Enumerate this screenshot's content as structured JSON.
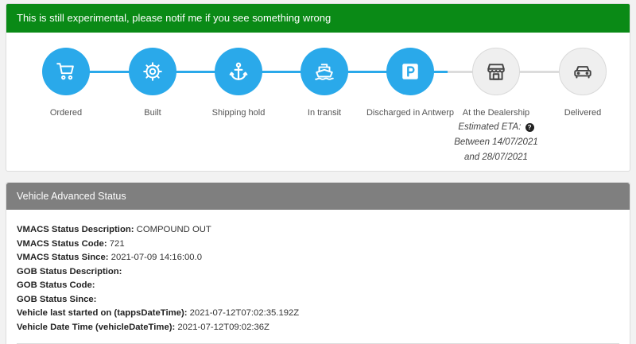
{
  "banner": {
    "text": "This is still experimental, please notif me if you see something wrong"
  },
  "colors": {
    "banner": "#0a8a16",
    "step_done": "#2aa9ea",
    "step_todo": "#efefef",
    "panel_header": "#7f7f7f"
  },
  "steps": [
    {
      "label": "Ordered",
      "icon": "cart-icon",
      "status": "done"
    },
    {
      "label": "Built",
      "icon": "gear-icon",
      "status": "done"
    },
    {
      "label": "Shipping hold",
      "icon": "anchor-icon",
      "status": "done"
    },
    {
      "label": "In transit",
      "icon": "ship-icon",
      "status": "done"
    },
    {
      "label": "Discharged in Antwerp",
      "icon": "parking-icon",
      "status": "done"
    },
    {
      "label": "At the Dealership",
      "icon": "store-icon",
      "status": "todo"
    },
    {
      "label": "Delivered",
      "icon": "car-icon",
      "status": "todo"
    }
  ],
  "eta": {
    "label": "Estimated ETA:",
    "help_icon": "question-circle-icon",
    "help_glyph": "?",
    "line1": "Between 14/07/2021",
    "line2": "and 28/07/2021"
  },
  "advanced": {
    "title": "Vehicle Advanced Status",
    "rows": [
      {
        "label": "VMACS Status Description:",
        "value": "COMPOUND OUT"
      },
      {
        "label": "VMACS Status Code:",
        "value": "721"
      },
      {
        "label": "VMACS Status Since:",
        "value": "2021-07-09 14:16:00.0"
      },
      {
        "label": "GOB Status Description:",
        "value": ""
      },
      {
        "label": "GOB Status Code:",
        "value": ""
      },
      {
        "label": "GOB Status Since:",
        "value": ""
      },
      {
        "label": "Vehicle last started on (tappsDateTime):",
        "value": "2021-07-12T07:02:35.192Z"
      },
      {
        "label": "Vehicle Date Time (vehicleDateTime):",
        "value": "2021-07-12T09:02:36Z"
      }
    ]
  }
}
